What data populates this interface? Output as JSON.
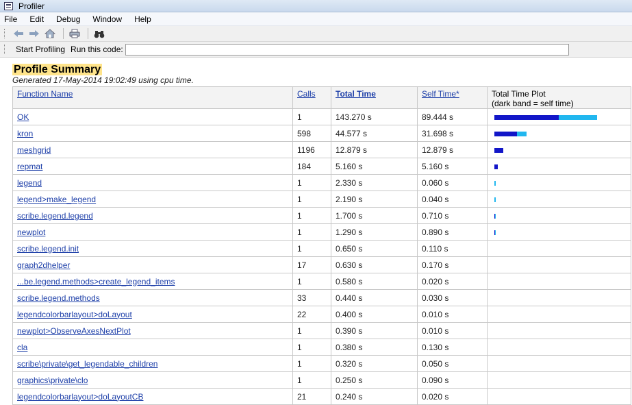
{
  "window": {
    "title": "Profiler"
  },
  "menu": [
    "File",
    "Edit",
    "Debug",
    "Window",
    "Help"
  ],
  "runbar": {
    "start_label": "Start Profiling",
    "run_label": "Run this code:",
    "code_value": ""
  },
  "summary": {
    "title": "Profile Summary",
    "generated": "Generated 17-May-2014 19:02:49 using cpu time."
  },
  "columns": {
    "function_name": "Function Name",
    "calls": "Calls",
    "total_time": "Total Time",
    "self_time": "Self Time*",
    "plot": "Total Time Plot",
    "plot_sub": "(dark band = self time)"
  },
  "colors": {
    "dark_band": "#1216c8",
    "light_band": "#21b7ef",
    "link": "#1c3ea8",
    "title_highlight": "#ffe48a"
  },
  "plot_scale_max_seconds": 143.27,
  "rows": [
    {
      "name": "OK",
      "calls": "1",
      "total": "143.270 s",
      "self": "89.444 s",
      "total_s": 143.27,
      "self_s": 89.444
    },
    {
      "name": "kron",
      "calls": "598",
      "total": "44.577 s",
      "self": "31.698 s",
      "total_s": 44.577,
      "self_s": 31.698
    },
    {
      "name": "meshgrid",
      "calls": "1196",
      "total": "12.879 s",
      "self": "12.879 s",
      "total_s": 12.879,
      "self_s": 12.879
    },
    {
      "name": "repmat",
      "calls": "184",
      "total": "5.160 s",
      "self": "5.160 s",
      "total_s": 5.16,
      "self_s": 5.16
    },
    {
      "name": "legend",
      "calls": "1",
      "total": "2.330 s",
      "self": "0.060 s",
      "total_s": 2.33,
      "self_s": 0.06
    },
    {
      "name": "legend>make_legend",
      "calls": "1",
      "total": "2.190 s",
      "self": "0.040 s",
      "total_s": 2.19,
      "self_s": 0.04
    },
    {
      "name": "scribe.legend.legend",
      "calls": "1",
      "total": "1.700 s",
      "self": "0.710 s",
      "total_s": 1.7,
      "self_s": 0.71
    },
    {
      "name": "newplot",
      "calls": "1",
      "total": "1.290 s",
      "self": "0.890 s",
      "total_s": 1.29,
      "self_s": 0.89
    },
    {
      "name": "scribe.legend.init",
      "calls": "1",
      "total": "0.650 s",
      "self": "0.110 s",
      "total_s": 0,
      "self_s": 0
    },
    {
      "name": "graph2dhelper",
      "calls": "17",
      "total": "0.630 s",
      "self": "0.170 s",
      "total_s": 0,
      "self_s": 0
    },
    {
      "name": "...be.legend.methods>create_legend_items",
      "calls": "1",
      "total": "0.580 s",
      "self": "0.020 s",
      "total_s": 0,
      "self_s": 0
    },
    {
      "name": "scribe.legend.methods",
      "calls": "33",
      "total": "0.440 s",
      "self": "0.030 s",
      "total_s": 0,
      "self_s": 0
    },
    {
      "name": "legendcolorbarlayout>doLayout",
      "calls": "22",
      "total": "0.400 s",
      "self": "0.010 s",
      "total_s": 0,
      "self_s": 0
    },
    {
      "name": "newplot>ObserveAxesNextPlot",
      "calls": "1",
      "total": "0.390 s",
      "self": "0.010 s",
      "total_s": 0,
      "self_s": 0
    },
    {
      "name": "cla",
      "calls": "1",
      "total": "0.380 s",
      "self": "0.130 s",
      "total_s": 0,
      "self_s": 0
    },
    {
      "name": "scribe\\private\\get_legendable_children",
      "calls": "1",
      "total": "0.320 s",
      "self": "0.050 s",
      "total_s": 0,
      "self_s": 0
    },
    {
      "name": "graphics\\private\\clo",
      "calls": "1",
      "total": "0.250 s",
      "self": "0.090 s",
      "total_s": 0,
      "self_s": 0
    },
    {
      "name": "legendcolorbarlayout>doLayoutCB",
      "calls": "21",
      "total": "0.240 s",
      "self": "0.020 s",
      "total_s": 0,
      "self_s": 0
    }
  ]
}
